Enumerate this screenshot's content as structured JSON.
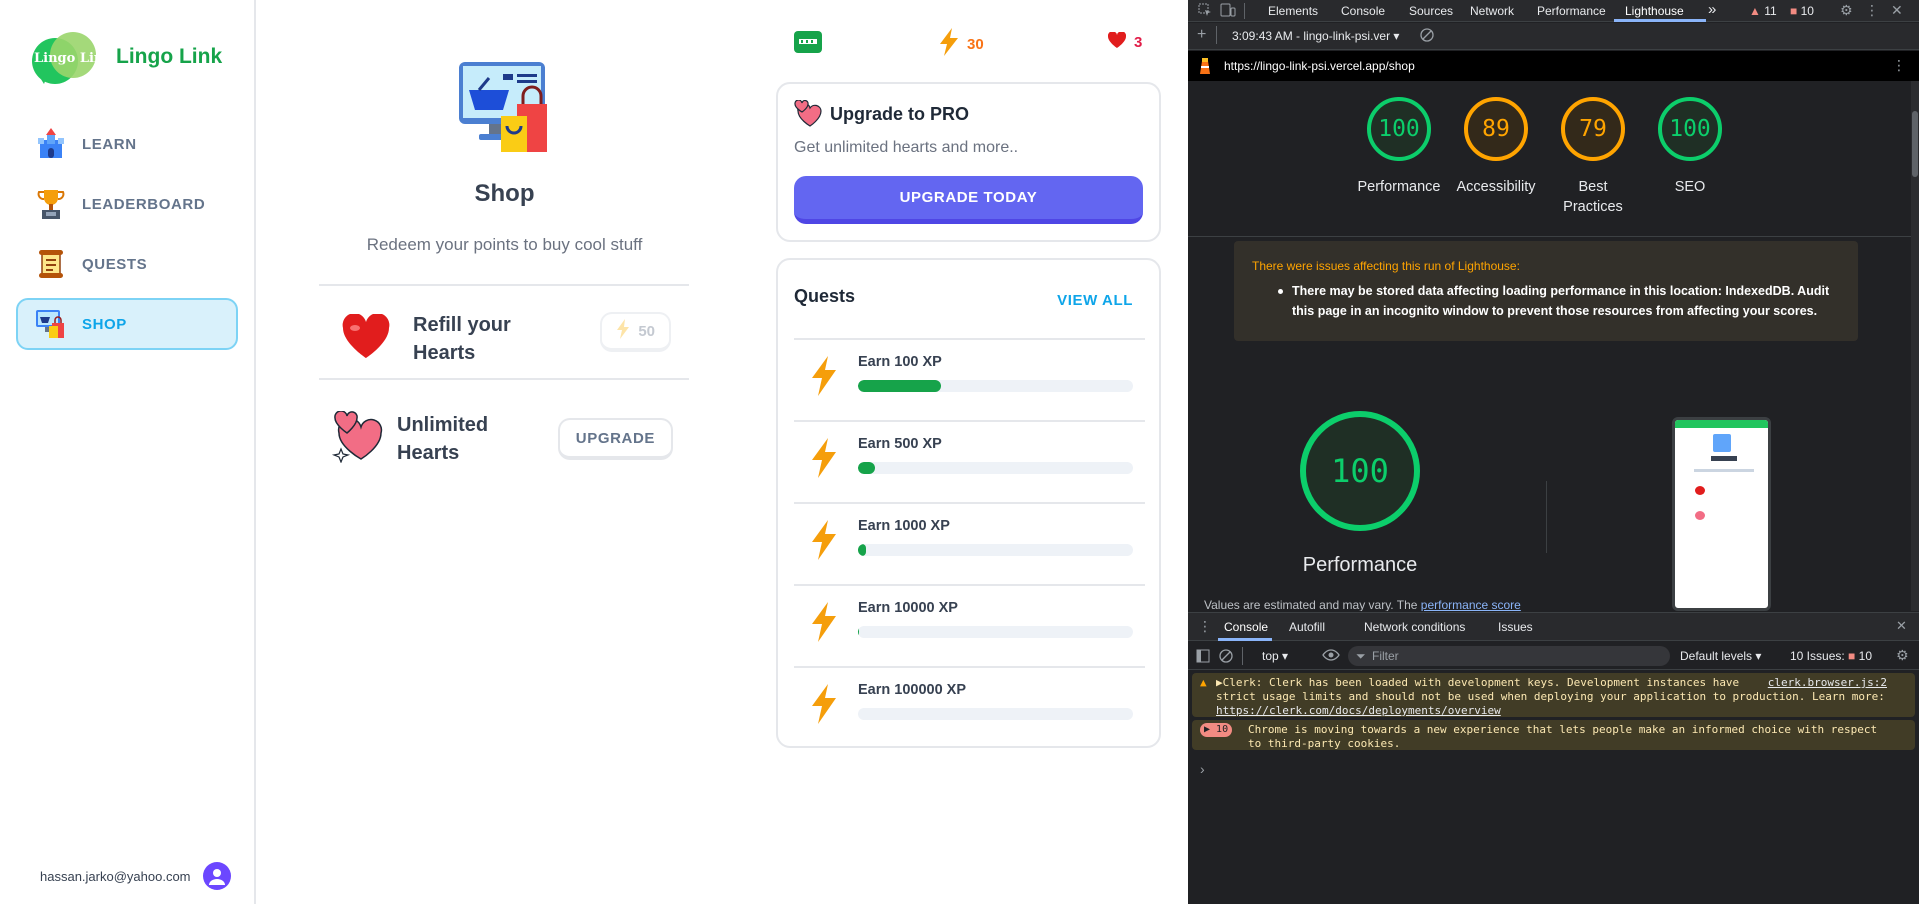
{
  "app": {
    "title": "Lingo Link",
    "logo_text": "Lingo Link"
  },
  "sidebar": {
    "items": [
      {
        "label": "LEARN",
        "icon": "castle-icon"
      },
      {
        "label": "LEADERBOARD",
        "icon": "trophy-icon"
      },
      {
        "label": "QUESTS",
        "icon": "scroll-icon"
      },
      {
        "label": "SHOP",
        "icon": "shop-icon",
        "active": true
      }
    ],
    "user_email": "hassan.jarko@yahoo.com"
  },
  "shop": {
    "title": "Shop",
    "subtitle": "Redeem your points to buy cool stuff",
    "items": [
      {
        "title_line1": "Refill your",
        "title_line2": "Hearts",
        "cost": "50"
      },
      {
        "title_line1": "Unlimited",
        "title_line2": "Hearts",
        "button": "UPGRADE"
      }
    ]
  },
  "stats": {
    "points": "30",
    "hearts": "3",
    "flag": "flag-icon"
  },
  "pro": {
    "title": "Upgrade to PRO",
    "subtitle": "Get unlimited hearts and more..",
    "button": "UPGRADE TODAY"
  },
  "quests": {
    "title": "Quests",
    "view_all": "VIEW ALL",
    "items": [
      {
        "label": "Earn 100 XP",
        "progress": 0.3
      },
      {
        "label": "Earn 500 XP",
        "progress": 0.06
      },
      {
        "label": "Earn 1000 XP",
        "progress": 0.03
      },
      {
        "label": "Earn 10000 XP",
        "progress": 0.003
      },
      {
        "label": "Earn 100000 XP",
        "progress": 0.0
      }
    ]
  },
  "devtools": {
    "tabs": [
      "Elements",
      "Console",
      "Sources",
      "Network",
      "Performance",
      "Lighthouse"
    ],
    "active_tab": "Lighthouse",
    "more": "»",
    "warn_count": "11",
    "issue_count": "10",
    "report_label": "3:09:43 AM - lingo-link-psi.ver",
    "url": "https://lingo-link-psi.vercel.app/shop",
    "scores": [
      {
        "value": "100",
        "label": "Performance",
        "color": "#0cce6b"
      },
      {
        "value": "89",
        "label": "Accessibility",
        "color": "#ffa400"
      },
      {
        "value": "79",
        "label": "Best Practices",
        "color": "#ffa400"
      },
      {
        "value": "100",
        "label": "SEO",
        "color": "#0cce6b"
      }
    ],
    "warning_title": "There were issues affecting this run of Lighthouse:",
    "warning_text": "There may be stored data affecting loading performance in this location: IndexedDB. Audit this page in an incognito window to prevent those resources from affecting your scores.",
    "big_score": "100",
    "big_label": "Performance",
    "estimate_text": "Values are estimated and may vary. The",
    "estimate_link": "performance score",
    "console": {
      "tabs": [
        "Console",
        "Autofill",
        "Network conditions",
        "Issues"
      ],
      "context": "top",
      "filter_placeholder": "Filter",
      "levels": "Default levels",
      "issues": "10 Issues:",
      "issues_count": "10",
      "msg1_line1": "▶Clerk: Clerk has been loaded with development keys. Development instances have",
      "msg1_source": "clerk.browser.js:2",
      "msg1_line2": "strict usage limits and should not be used when deploying your application to production. Learn more:",
      "msg1_link": "https://clerk.com/docs/deployments/overview",
      "msg2_count": "10",
      "msg2_line1": "Chrome is moving towards a new experience that lets people make an informed choice with respect",
      "msg2_line2": "to third-party cookies.",
      "prompt": "›"
    }
  },
  "colors": {
    "accent": "#16a34a",
    "shop_active": "#0ea5e9",
    "pro_button": "#6366f1",
    "points": "#f97316",
    "hearts": "#e11d48"
  }
}
